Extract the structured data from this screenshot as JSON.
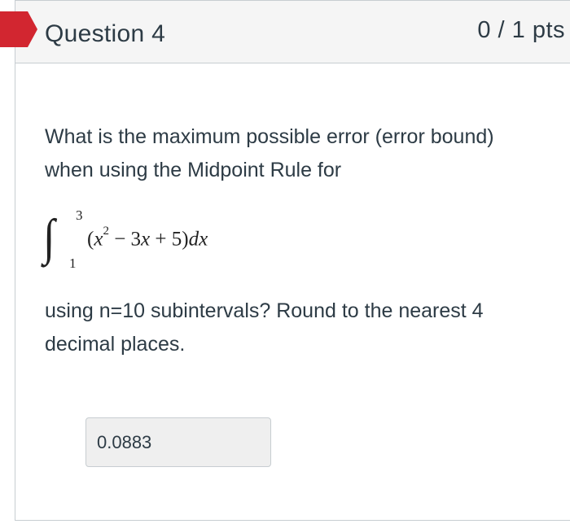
{
  "header": {
    "title": "Question 4",
    "points": "0 / 1 pts",
    "flag_color": "#d22630"
  },
  "question": {
    "text_before": "What is the maximum possible error (error bound) when using the Midpoint Rule for",
    "math": {
      "integral_sign": "∫",
      "upper_limit": "3",
      "lower_limit": "1",
      "integrand_open": "(",
      "x1": "x",
      "exponent": "2",
      "minus_term": " − 3",
      "x2": "x",
      "plus_term": " + 5)",
      "dx": "dx"
    },
    "text_after": "using n=10 subintervals? Round to the nearest 4 decimal places."
  },
  "answer": {
    "value": "0.0883"
  }
}
